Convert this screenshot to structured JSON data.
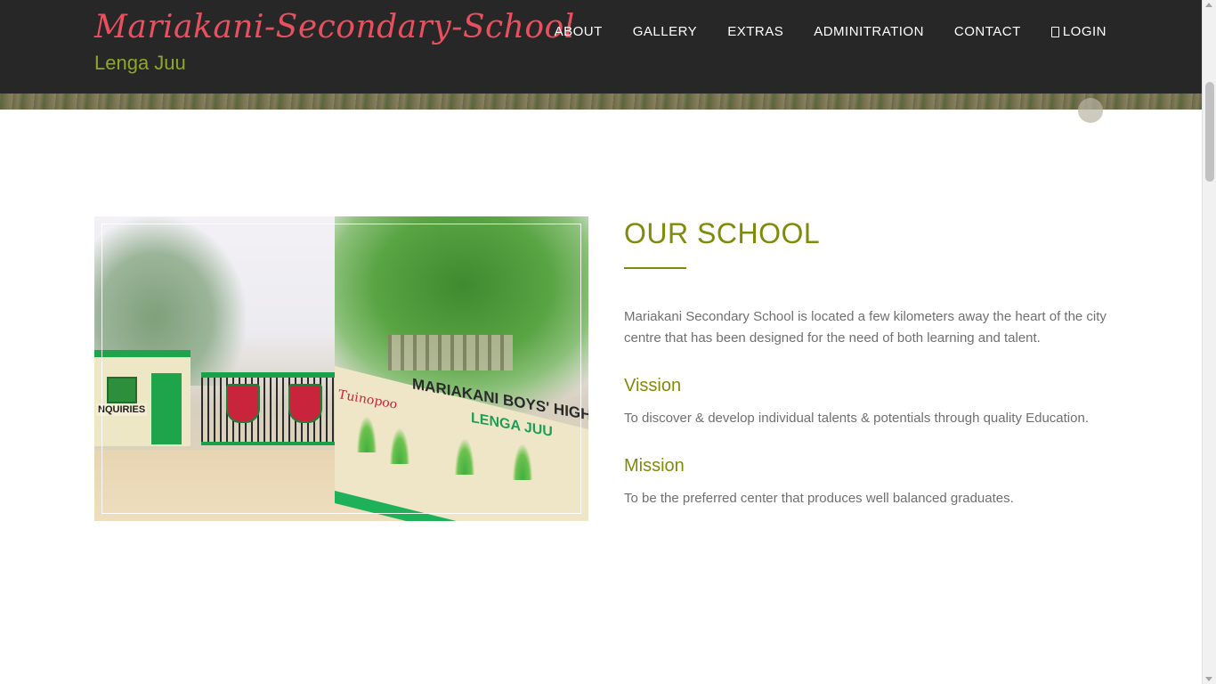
{
  "header": {
    "brand_title": "Mariakani-Secondary-School",
    "tagline": "Lenga Juu",
    "nav": [
      {
        "label": "ABOUT"
      },
      {
        "label": "GALLERY"
      },
      {
        "label": "EXTRAS"
      },
      {
        "label": "ADMINITRATION"
      },
      {
        "label": "CONTACT"
      },
      {
        "label": "LOGIN",
        "icon": "lock-icon"
      }
    ]
  },
  "about": {
    "title": "OUR SCHOOL",
    "intro": "Mariakani Secondary School is located a few kilometers away the heart of the city centre that has been designed for the need of both learning and talent.",
    "vision_heading": "Vission",
    "vision_text": "To discover & develop individual talents & potentials through quality Education.",
    "mission_heading": "Mission",
    "mission_text": "To be the preferred center that produces well balanced graduates."
  },
  "image": {
    "wall_sign": "MARIAKANI BOYS' HIGH",
    "wall_motto": "LENGA JUU",
    "gatehouse_sign": "NQUIRIES",
    "wall_script": "Tuinopoo"
  },
  "colors": {
    "header_bg": "#272727",
    "brand": "#e8505f",
    "accent": "#7f8c0a",
    "tagline": "#8ea72b",
    "body_text": "#707070"
  }
}
